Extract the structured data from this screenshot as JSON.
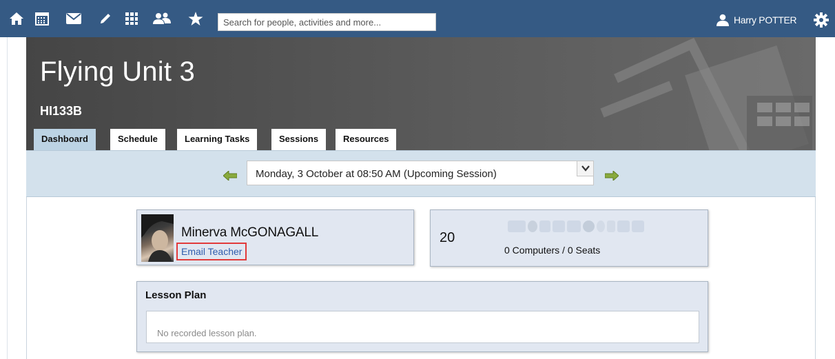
{
  "nav": {
    "icons": [
      "home-icon",
      "calendar-icon",
      "mail-icon",
      "pencil-icon",
      "apps-grid-icon",
      "people-icon",
      "star-icon"
    ],
    "search_placeholder": "Search for people, activities and more...",
    "user_name": "Harry POTTER",
    "colors": {
      "bar": "#355a84"
    }
  },
  "unit": {
    "title": "Flying Unit 3",
    "code": "HI133B"
  },
  "tabs": [
    {
      "label": "Dashboard",
      "active": true
    },
    {
      "label": "Schedule",
      "active": false
    },
    {
      "label": "Learning Tasks",
      "active": false
    },
    {
      "label": "Sessions",
      "active": false
    },
    {
      "label": "Resources",
      "active": false
    }
  ],
  "session": {
    "selected": "Monday, 3 October at 08:50 AM (Upcoming Session)"
  },
  "teacher": {
    "name": "Minerva McGONAGALL",
    "email_label": "Email Teacher"
  },
  "room": {
    "number": "20",
    "seats": "0 Computers / 0 Seats",
    "equipment_icons": [
      "projector-icon",
      "lightbulb-icon",
      "speaker-icon",
      "marker-icon",
      "whiteboard-icon",
      "disc-icon",
      "water-icon",
      "tap-icon",
      "socket-icon",
      "power-socket-icon"
    ]
  },
  "lesson_plan": {
    "title": "Lesson Plan",
    "empty_text": "No recorded lesson plan."
  }
}
